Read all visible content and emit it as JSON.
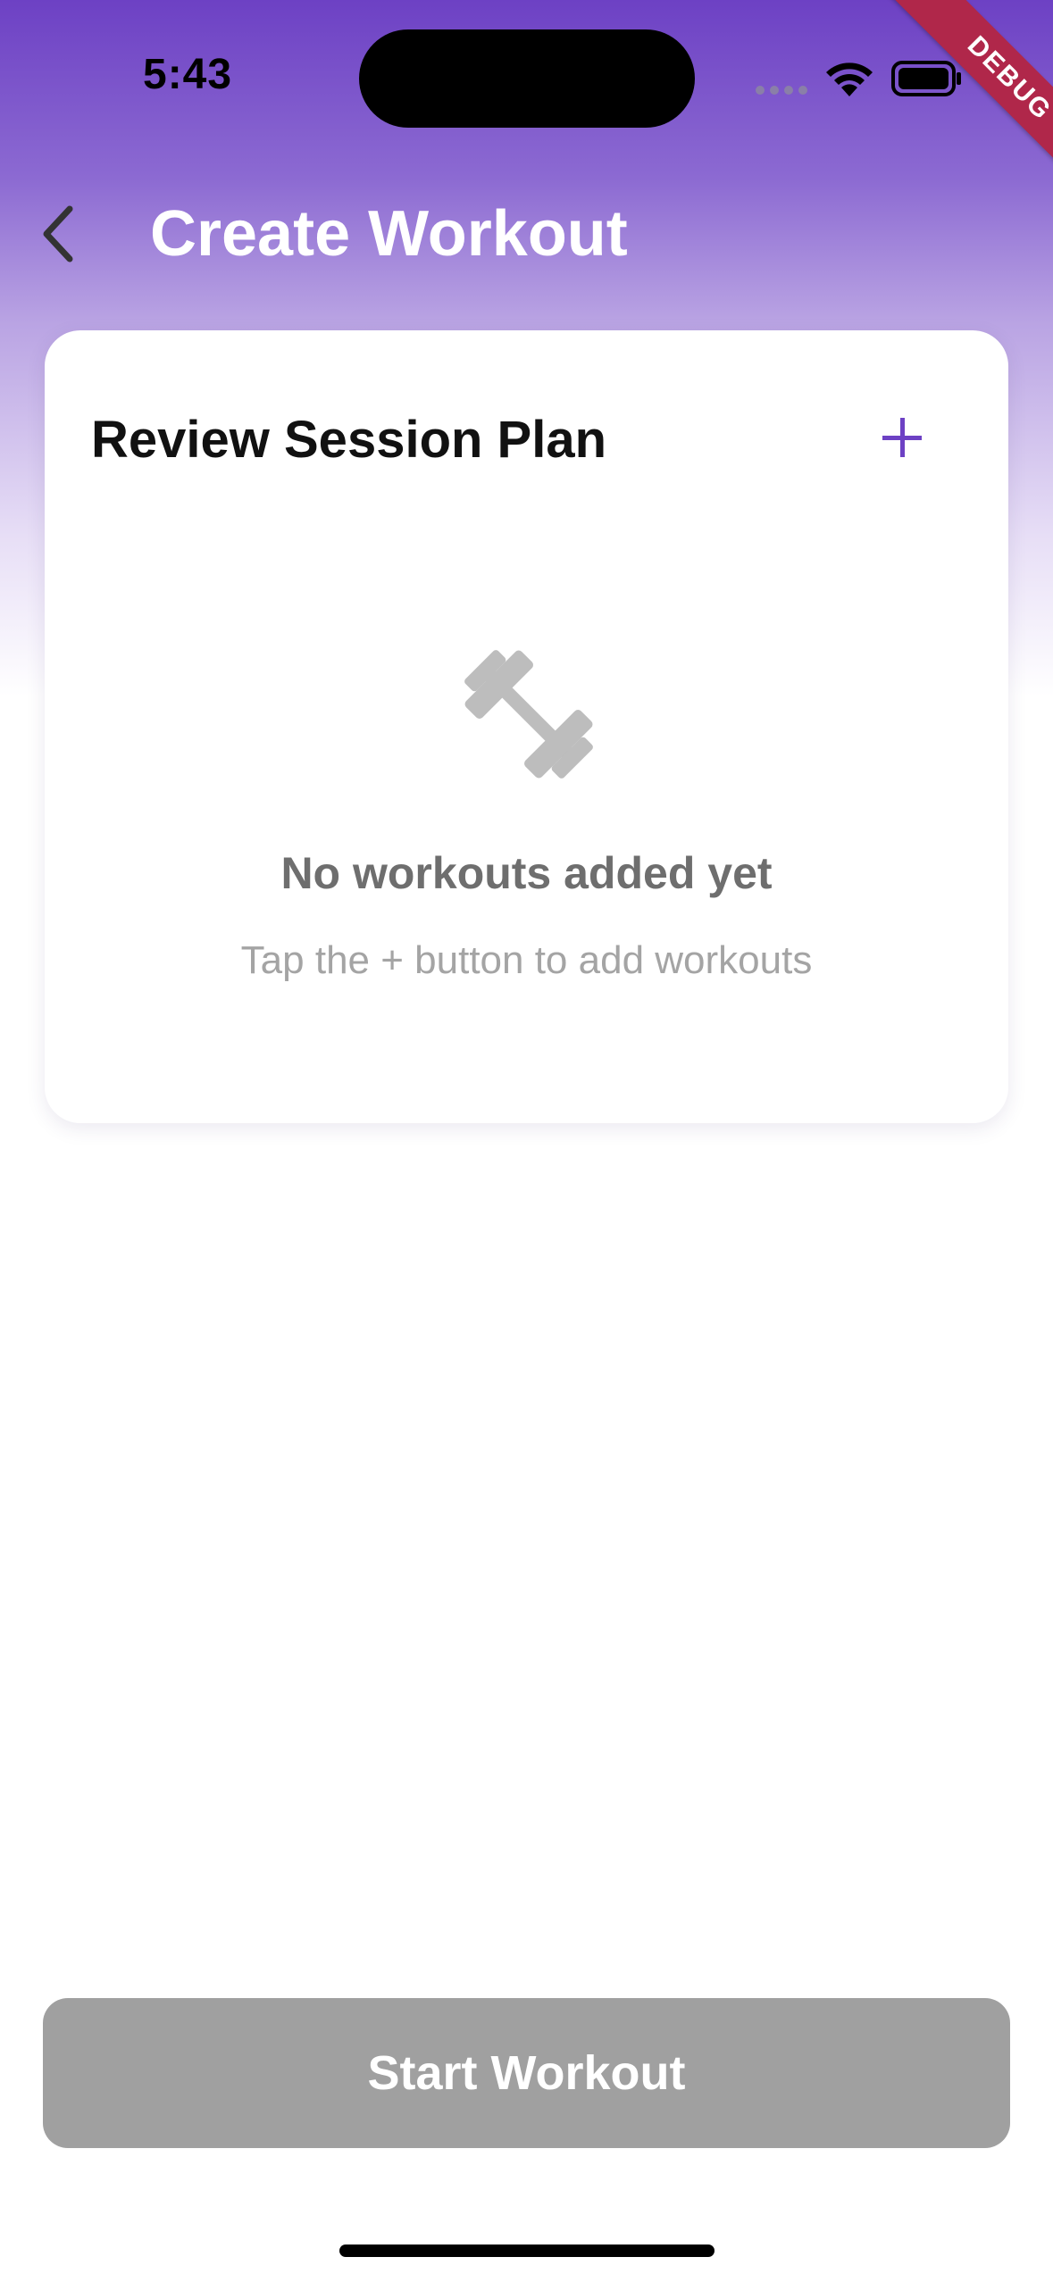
{
  "status_bar": {
    "time": "5:43",
    "debug_label": "DEBUG"
  },
  "header": {
    "title": "Create Workout",
    "back_icon": "chevron-left-icon"
  },
  "session_card": {
    "title": "Review Session Plan",
    "add_icon": "plus-icon",
    "empty_state": {
      "icon": "barbell-icon",
      "title": "No workouts added yet",
      "subtitle": "Tap the + button to add workouts"
    }
  },
  "footer": {
    "start_button_label": "Start Workout"
  },
  "colors": {
    "accent": "#6d41c4",
    "disabled_button": "#a0a0a0",
    "debug_ribbon": "#b0274a"
  }
}
